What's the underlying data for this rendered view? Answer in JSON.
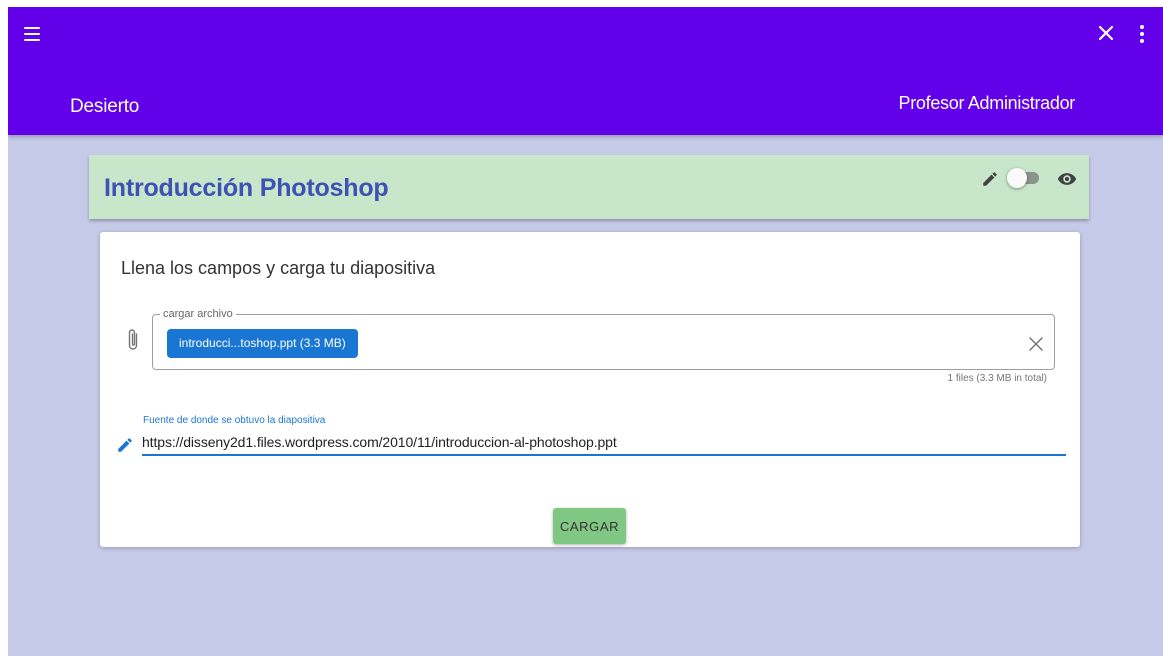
{
  "topbar": {
    "app_title": "Desierto",
    "user_name": "Profesor Administrador",
    "menu_icon": "hamburger-menu-icon",
    "close_icon": "close-icon",
    "more_icon": "more-vert-icon",
    "background_color": "#6200ea"
  },
  "course": {
    "title": "Introducción Photoshop",
    "edit_icon": "pencil-icon",
    "visibility_toggle_on": false,
    "view_icon": "eye-icon",
    "card_color": "#c8e6c9"
  },
  "form": {
    "heading": "Llena los campos y carga tu diapositiva",
    "file_field": {
      "legend": "cargar archivo",
      "chip_label": "introducci...toshop.ppt (3.3 MB)",
      "files_summary": "1 files (3.3 MB in total)",
      "attach_icon": "paperclip-icon",
      "clear_icon": "clear-icon"
    },
    "source_field": {
      "label": "Fuente de donde se obtuvo la diapositiva",
      "value": "https://disseny2d1.files.wordpress.com/2010/11/introduccion-al-photoshop.ppt",
      "icon": "pencil-icon"
    },
    "submit_label": "CARGAR",
    "submit_color": "#81c784"
  },
  "page_background": "#c5cae9"
}
